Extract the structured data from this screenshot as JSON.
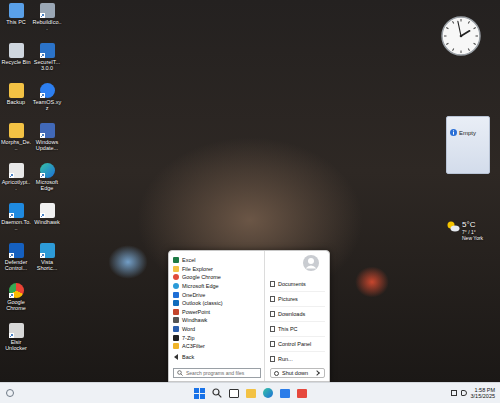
{
  "desktop": {
    "columns": [
      {
        "icons": [
          {
            "label": "This PC",
            "shortcut": false
          },
          {
            "label": "Recycle Bin",
            "shortcut": false
          },
          {
            "label": "Backup",
            "shortcut": false
          },
          {
            "label": "Morphs_De...",
            "shortcut": false
          },
          {
            "label": "Apricotlypt...",
            "shortcut": true
          },
          {
            "label": "Daemon.To...",
            "shortcut": true
          },
          {
            "label": "Defender Control...",
            "shortcut": true
          },
          {
            "label": "Google Chrome",
            "shortcut": true
          },
          {
            "label": "Elsir Unlocker",
            "shortcut": true
          }
        ]
      },
      {
        "icons": [
          {
            "label": "RebuildIco...",
            "shortcut": true
          },
          {
            "label": "SecureIT... 3.0.0",
            "shortcut": true
          },
          {
            "label": "TeamOS.xyz",
            "shortcut": true
          },
          {
            "label": "Windows Update...",
            "shortcut": true
          },
          {
            "label": "Microsoft Edge",
            "shortcut": true
          },
          {
            "label": "Windhawk",
            "shortcut": true
          },
          {
            "label": "Vista Shortc...",
            "shortcut": true
          }
        ]
      }
    ]
  },
  "gadgets": {
    "clock": {
      "hour": 13,
      "minute": 58
    },
    "notes": {
      "text": "Empty"
    },
    "weather": {
      "temperature": "5°C",
      "range": "7° / 1°",
      "city": "New York"
    }
  },
  "start_menu": {
    "programs": [
      "Excel",
      "File Explorer",
      "Google Chrome",
      "Microsoft Edge",
      "OneDrive",
      "Outlook (classic)",
      "PowerPoint",
      "Windhawk",
      "Word",
      "7-Zip",
      "AC3Filter"
    ],
    "back": "Back",
    "search_placeholder": "Search programs and files",
    "places": [
      "Documents",
      "Pictures",
      "Downloads",
      "This PC",
      "Control Panel",
      "Run..."
    ],
    "shutdown": "Shut down"
  },
  "taskbar": {
    "time": "1:58 PM",
    "date": "3/15/2025"
  }
}
